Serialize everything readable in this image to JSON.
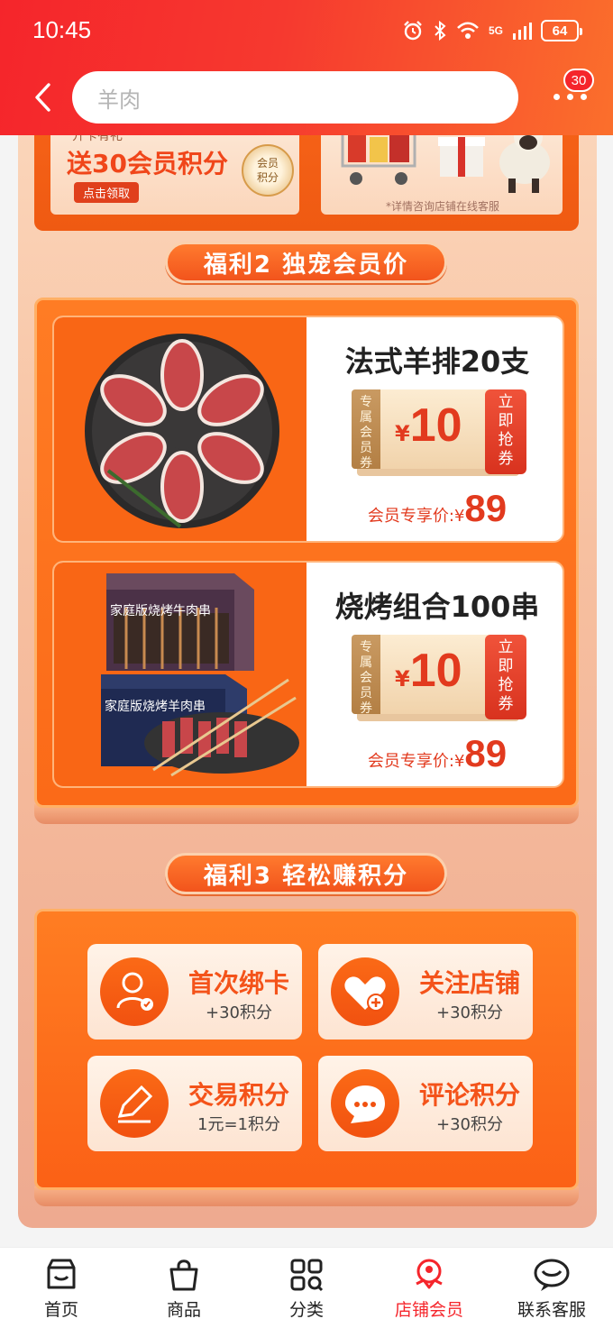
{
  "status": {
    "time": "10:45",
    "network": "5G",
    "battery": "64"
  },
  "header": {
    "search_placeholder": "羊肉",
    "badge_count": "30"
  },
  "promos": {
    "left": {
      "line1": "开卡有礼",
      "line2": "送30会员积分",
      "button": "点击领取",
      "coin": "会员积分"
    },
    "right": {
      "note": "*详情咨询店铺在线客服"
    }
  },
  "section2": {
    "title": "福利2 独宠会员价",
    "products": [
      {
        "name": "法式羊排20支",
        "coupon_side": "专属会员券",
        "coupon_yen": "¥",
        "coupon_amount": "10",
        "coupon_grab": "立即抢券",
        "price_label": "会员专享价:",
        "price_yen": "¥",
        "price": "89"
      },
      {
        "name": "烧烤组合100串",
        "coupon_side": "专属会员券",
        "coupon_yen": "¥",
        "coupon_amount": "10",
        "coupon_grab": "立即抢券",
        "price_label": "会员专享价:",
        "price_yen": "¥",
        "price": "89",
        "box_label_top": "家庭版烧烤牛肉串",
        "box_label_bottom": "家庭版烧烤羊肉串"
      }
    ]
  },
  "section3": {
    "title": "福利3 轻松赚积分",
    "items": [
      {
        "title": "首次绑卡",
        "sub": "+30积分",
        "icon": "user-check-icon"
      },
      {
        "title": "关注店铺",
        "sub": "+30积分",
        "icon": "heart-plus-icon"
      },
      {
        "title": "交易积分",
        "sub": "1元=1积分",
        "icon": "pencil-icon"
      },
      {
        "title": "评论积分",
        "sub": "+30积分",
        "icon": "chat-bubble-icon"
      }
    ]
  },
  "nav": {
    "items": [
      {
        "label": "首页",
        "icon": "shop-icon"
      },
      {
        "label": "商品",
        "icon": "bag-icon"
      },
      {
        "label": "分类",
        "icon": "grid-icon"
      },
      {
        "label": "店铺会员",
        "icon": "member-icon",
        "active": true
      },
      {
        "label": "联系客服",
        "icon": "service-icon"
      }
    ]
  },
  "colors": {
    "brand_red": "#f5252b",
    "accent_orange": "#fb6a18",
    "price_red": "#e23a1e"
  }
}
